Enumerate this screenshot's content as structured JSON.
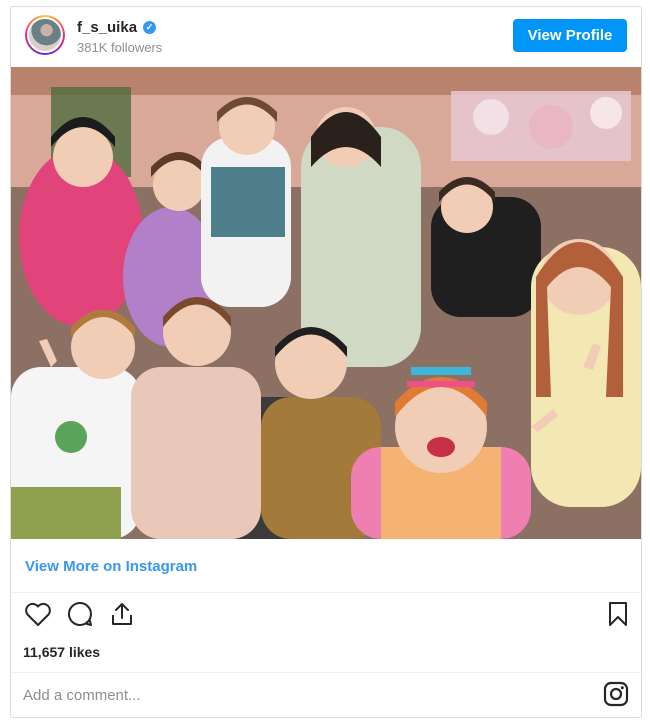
{
  "post": {
    "username": "f_s_uika",
    "verified_glyph": "✓",
    "followers": "381K followers",
    "view_profile_label": "View Profile",
    "photo_icon": "group-photo-image",
    "view_more_label": "View More on Instagram",
    "likes": "11,657 likes",
    "comment_placeholder": "Add a comment..."
  },
  "icons": {
    "like": "heart-icon",
    "comment": "comment-bubble-icon",
    "share": "share-icon",
    "save": "bookmark-icon",
    "brand": "instagram-logo-icon"
  },
  "colors": {
    "accent": "#0095f6",
    "link": "#3897f0",
    "muted": "#8e8e8e",
    "border": "#dbdbdb"
  }
}
